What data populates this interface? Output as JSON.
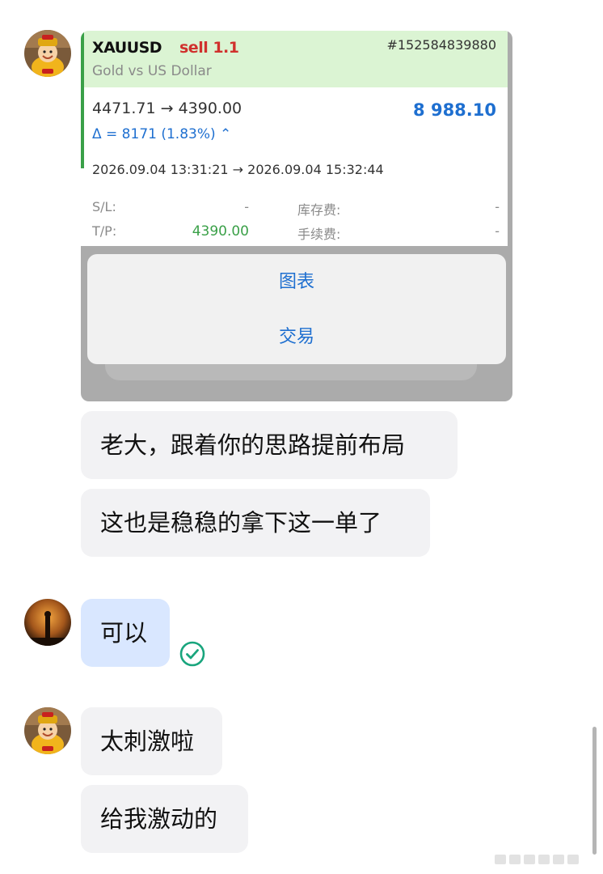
{
  "trade": {
    "symbol": "XAUUSD",
    "side": "sell 1.1",
    "ticket": "#152584839880",
    "description": "Gold vs US Dollar",
    "prices": "4471.71 → 4390.00",
    "profit": "8 988.10",
    "delta": "Δ = 8171 (1.83%) ⌃",
    "times": "2026.09.04 13:31:21 → 2026.09.04 15:32:44",
    "sl_label": "S/L:",
    "sl_value": "-",
    "tp_label": "T/P:",
    "tp_value": "4390.00",
    "swap_label": "库存费:",
    "swap_value": "-",
    "commission_label": "手续费:",
    "commission_value": "-",
    "menu": {
      "chart_label": "图表",
      "trade_label": "交易"
    }
  },
  "messages": [
    {
      "text": "老大，跟着你的思路提前布局"
    },
    {
      "text": "这也是稳稳的拿下这一单了"
    },
    {
      "text": "可以"
    },
    {
      "text": "太刺激啦"
    },
    {
      "text": "给我激动的"
    }
  ],
  "colors": {
    "sell": "#d0312d",
    "profit": "#1e6fd0",
    "tp": "#3aa048",
    "check": "#19a57d"
  },
  "icons": {
    "read_status": "check-circle-icon"
  }
}
